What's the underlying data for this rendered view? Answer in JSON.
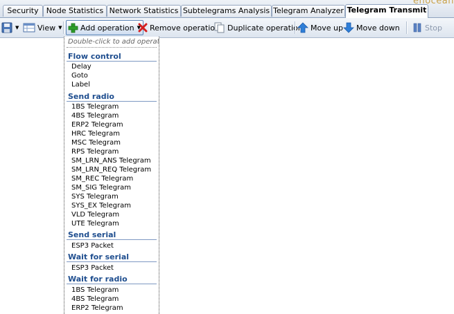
{
  "tabs": [
    {
      "label": "Security"
    },
    {
      "label": "Node Statistics"
    },
    {
      "label": "Network Statistics"
    },
    {
      "label": "Subtelegrams Analysis"
    },
    {
      "label": "Telegram Analyzer"
    },
    {
      "label": "Telegram Transmit",
      "active": true
    }
  ],
  "toolbar": {
    "save_icon": "save-icon",
    "view_label": "View",
    "add_operation_label": "Add operation",
    "remove_operation_label": "Remove operation",
    "duplicate_operation_label": "Duplicate operation",
    "move_up_label": "Move up",
    "move_down_label": "Move down",
    "stop_label": "Stop"
  },
  "dropdown": {
    "hint": "Double-click to add operation.",
    "sections": [
      {
        "title": "Flow control",
        "items": [
          "Delay",
          "Goto",
          "Label"
        ]
      },
      {
        "title": "Send radio",
        "items": [
          "1BS Telegram",
          "4BS Telegram",
          "ERP2 Telegram",
          "HRC Telegram",
          "MSC Telegram",
          "RPS Telegram",
          "SM_LRN_ANS Telegram",
          "SM_LRN_REQ Telegram",
          "SM_REC Telegram",
          "SM_SIG Telegram",
          "SYS Telegram",
          "SYS_EX Telegram",
          "VLD Telegram",
          "UTE Telegram"
        ]
      },
      {
        "title": "Send serial",
        "items": [
          "ESP3 Packet"
        ]
      },
      {
        "title": "Wait for serial",
        "items": [
          "ESP3 Packet"
        ]
      },
      {
        "title": "Wait for radio",
        "items": [
          "1BS Telegram",
          "4BS Telegram",
          "ERP2 Telegram"
        ]
      }
    ]
  },
  "colors": {
    "section_heading": "#1f4e8f",
    "add_icon": "#2e9e2a",
    "remove_icon": "#d42020",
    "arrow_icon": "#2f7fd8"
  }
}
